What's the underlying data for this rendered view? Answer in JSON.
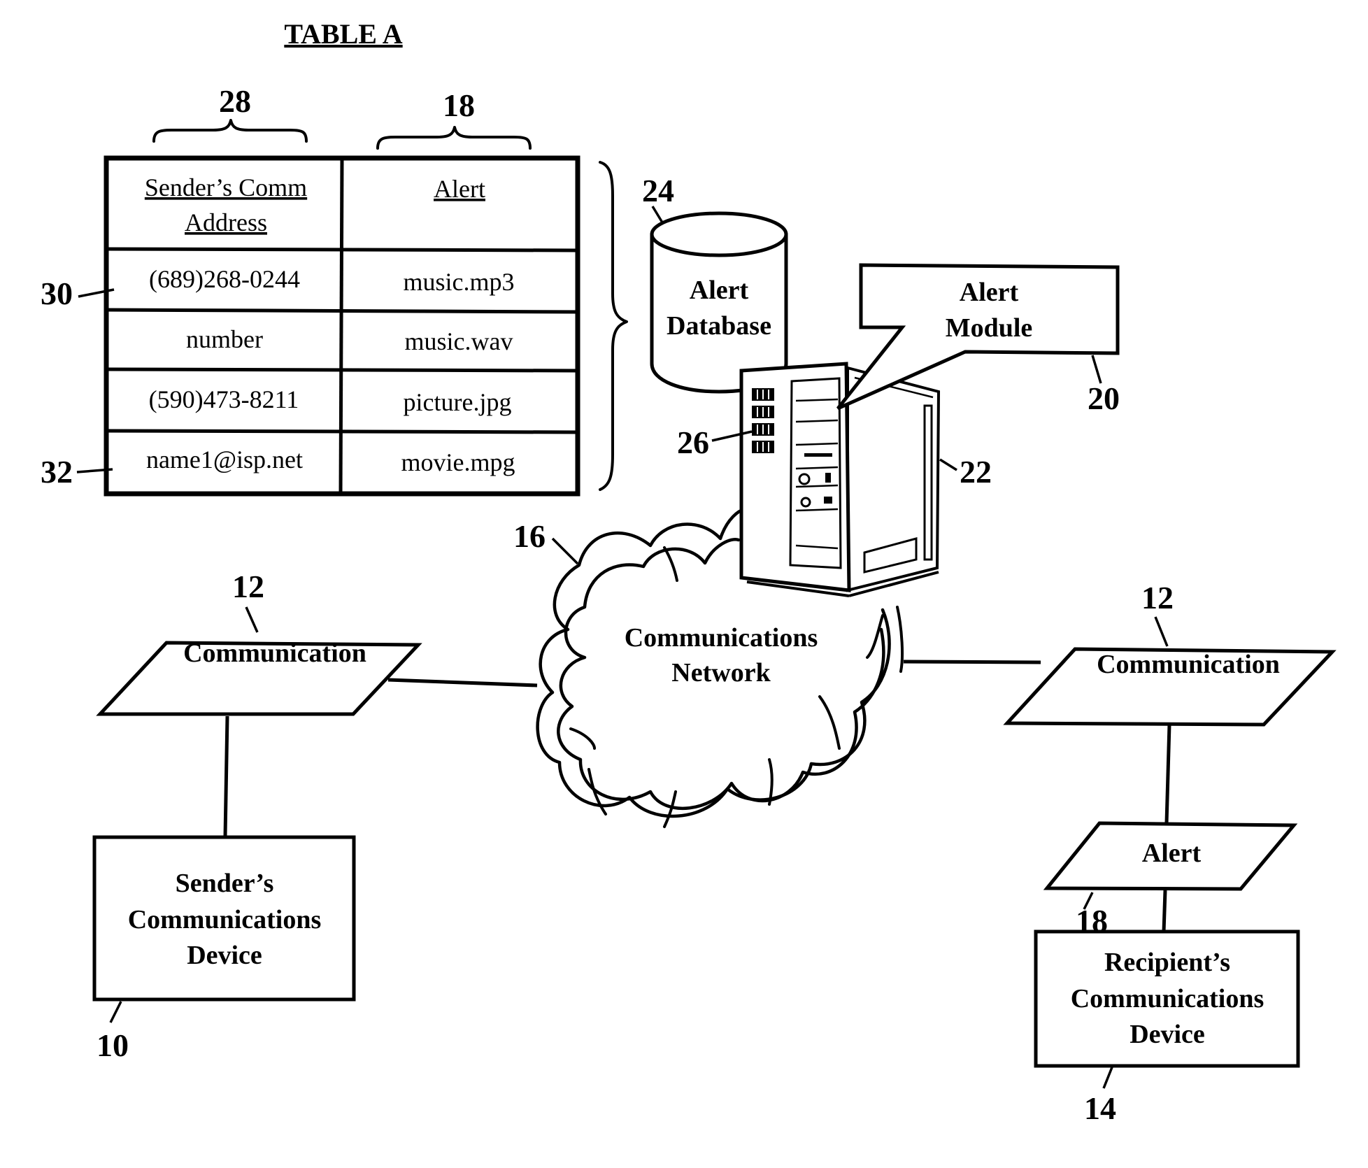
{
  "figure": {
    "title": "TABLE A",
    "table": {
      "ref": "28",
      "alert_ref": "18",
      "headers": [
        "Sender’s Comm Address",
        "Alert"
      ],
      "header_lines": [
        [
          "Sender’s Comm",
          "Address"
        ],
        [
          "Alert"
        ]
      ],
      "rows": [
        {
          "address": "(689)268-0244",
          "alert": "music.mp3",
          "ref": "30"
        },
        {
          "address": "number",
          "alert": "music.wav",
          "ref": ""
        },
        {
          "address": "(590)473-8211",
          "alert": "picture.jpg",
          "ref": ""
        },
        {
          "address": "name1@isp.net",
          "alert": "movie.mpg",
          "ref": "32"
        }
      ]
    },
    "alert_database": {
      "label_lines": [
        "Alert",
        "Database"
      ],
      "ref": "24"
    },
    "alert_module": {
      "label_lines": [
        "Alert",
        "Module"
      ],
      "ref": "20"
    },
    "server": {
      "ref": "22",
      "bay_ref": "26"
    },
    "network": {
      "label_lines": [
        "Communications",
        "Network"
      ],
      "ref": "16"
    },
    "sender_communication": {
      "label": "Communication",
      "ref": "12"
    },
    "sender_device": {
      "label_lines": [
        "Sender’s",
        "Communications",
        "Device"
      ],
      "ref": "10"
    },
    "recipient_communication": {
      "label": "Communication",
      "ref": "12"
    },
    "recipient_alert": {
      "label": "Alert",
      "ref": "18"
    },
    "recipient_device": {
      "label_lines": [
        "Recipient’s",
        "Communications",
        "Device"
      ],
      "ref": "14"
    }
  }
}
